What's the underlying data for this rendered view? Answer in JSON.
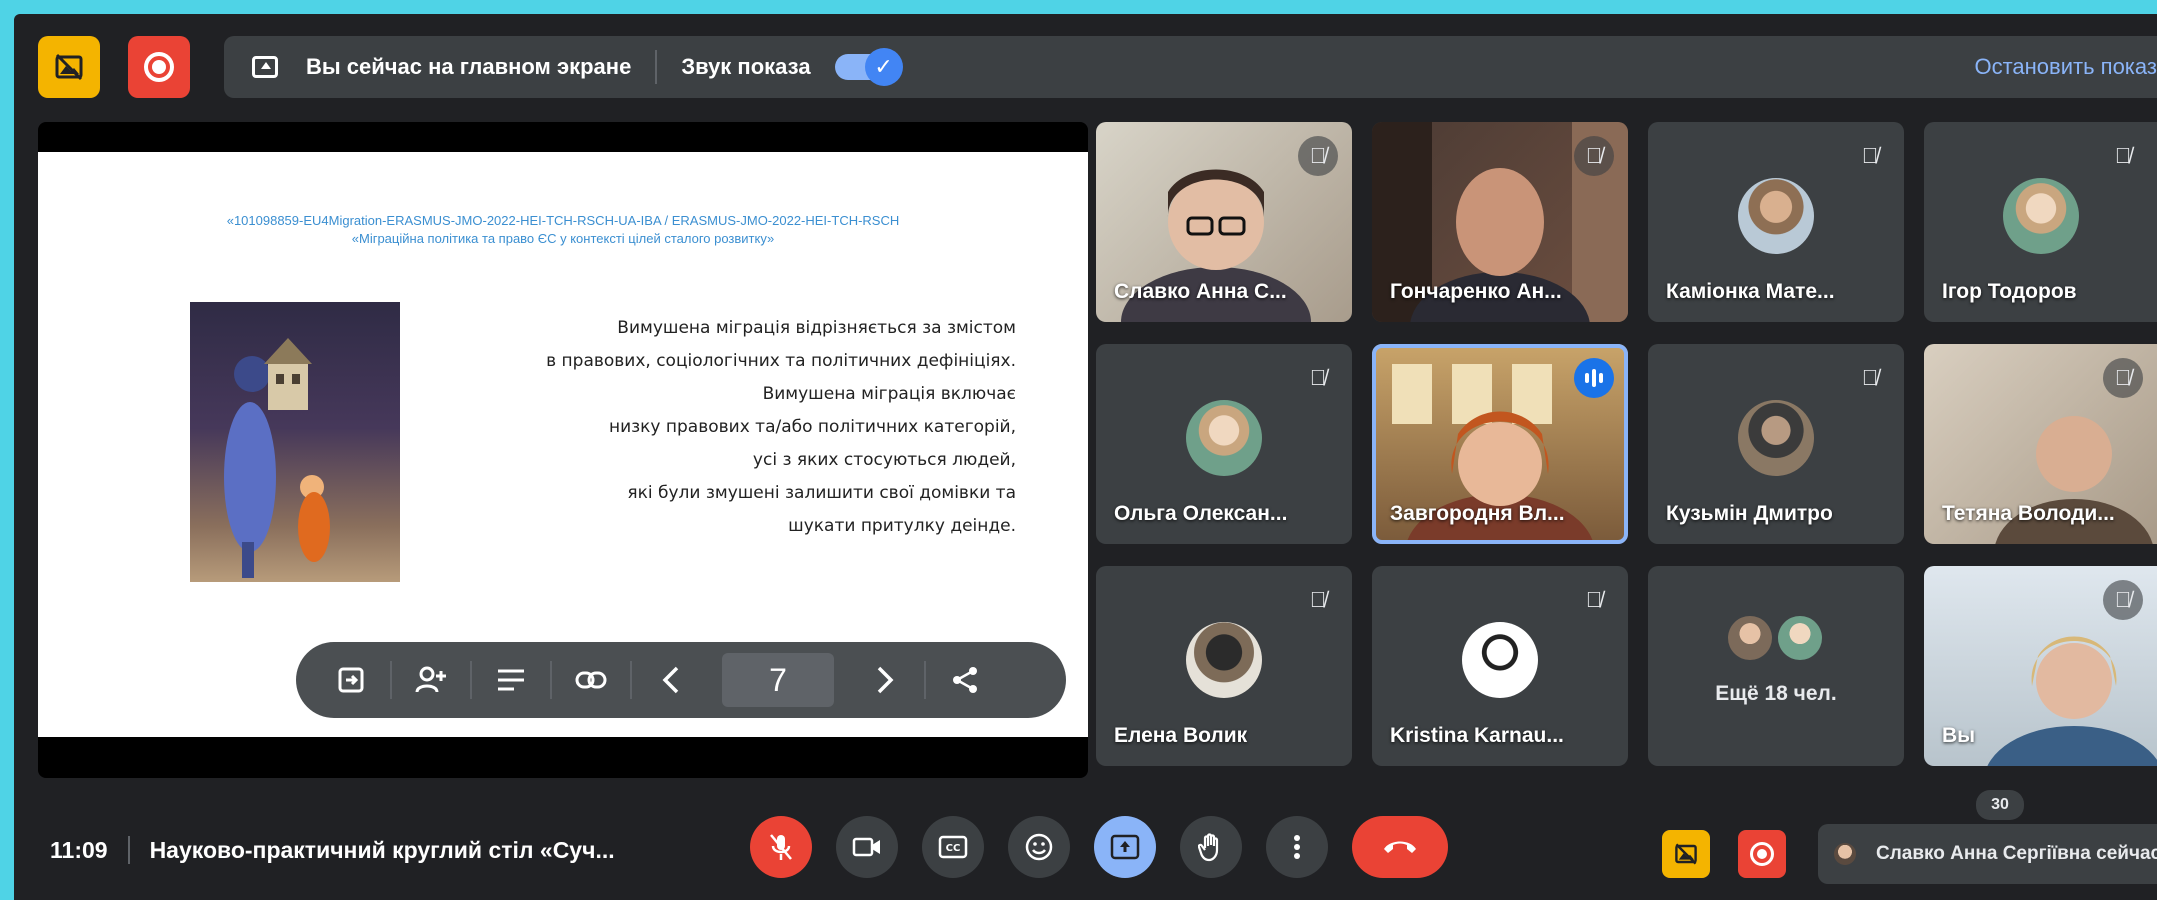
{
  "topbar": {
    "sharing_status": "Вы сейчас на главном экране",
    "audio_label": "Звук показа",
    "stop_label": "Остановить показ"
  },
  "slide": {
    "header_line1": "«101098859-EU4Migration-ERASMUS-JMO-2022-HEI-TCH-RSCH-UA-IBA / ERASMUS-JMO-2022-HEI-TCH-RSCH",
    "header_line2": "«Міграційна політика та право ЄС у контексті цілей сталого розвитку»",
    "body_lines": [
      "Вимушена міграція відрізняється за змістом",
      "в правових, соціологічних та політичних дефініціях.",
      "Вимушена міграція включає",
      "низку правових та/або політичних категорій,",
      "усі з яких стосуються людей,",
      "які були змушені залишити свої домівки та",
      "шукати притулку деінде."
    ],
    "page_number": "7"
  },
  "participants": [
    {
      "name": "Славко Анна С..."
    },
    {
      "name": "Гончаренко Ан..."
    },
    {
      "name": "Каміонка Мате..."
    },
    {
      "name": "Ігор Тодоров"
    },
    {
      "name": "Ольга Олексан..."
    },
    {
      "name": "Завгородня Вл..."
    },
    {
      "name": "Кузьмін Дмитро"
    },
    {
      "name": "Тетяна Володи..."
    },
    {
      "name": "Елена Волик"
    },
    {
      "name": "Kristina Karnau..."
    },
    {
      "name": "Ещё 18 чел."
    },
    {
      "name": "Вы"
    }
  ],
  "bottombar": {
    "time": "11:09",
    "meeting_title": "Науково-практичний круглий стіл «Суч...",
    "participant_count": "30",
    "presenter": "Славко Анна Сергіївна сейчас показывает"
  },
  "colors": {
    "accent": "#8ab4f8",
    "danger": "#ea4335",
    "warning": "#f4b400",
    "surface": "#3c4043",
    "background": "#202124"
  }
}
